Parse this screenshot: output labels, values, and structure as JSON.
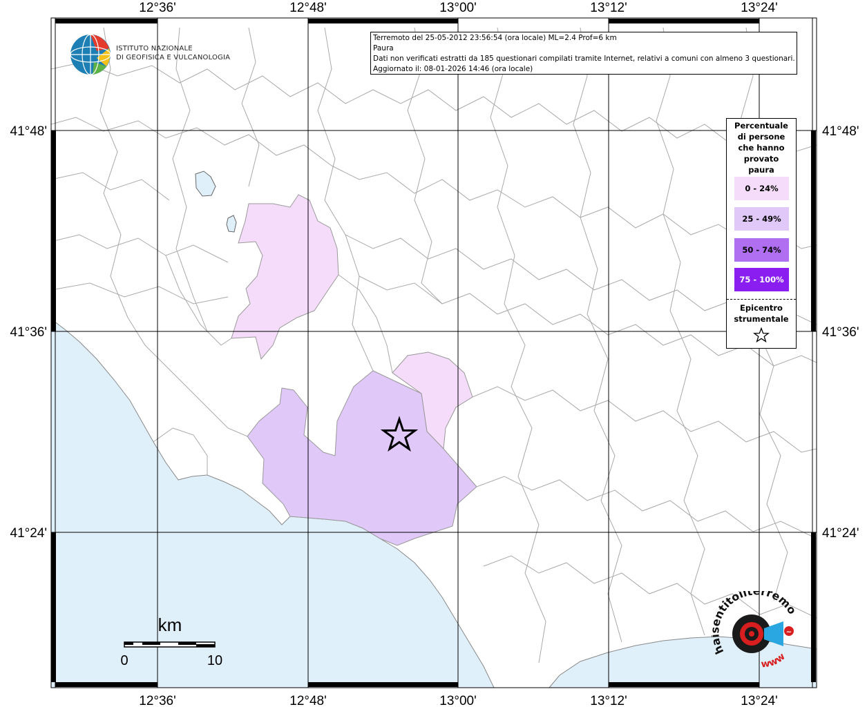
{
  "map": {
    "lon_ticks": [
      "12°36'",
      "12°48'",
      "13°00'",
      "13°12'",
      "13°24'"
    ],
    "lat_ticks": [
      "41°48'",
      "41°36'",
      "41°24'"
    ]
  },
  "info_box": {
    "line1": "Terremoto del 25-05-2012 23:56:54 (ora locale) ML=2.4 Prof=6 km",
    "line2": "Paura",
    "line3": "Dati non verificati estratti da 185 questionari compilati tramite Internet, relativi a comuni con almeno 3 questionari.",
    "line4": "Aggiornato il: 08-01-2026 14:46 (ora locale)"
  },
  "logo": {
    "line1": "ISTITUTO NAZIONALE",
    "line2": "DI GEOFISICA E VULCANOLOGIA"
  },
  "legend": {
    "title": [
      "Percentuale",
      "di persone",
      "che hanno",
      "provato",
      "paura"
    ],
    "classes": [
      {
        "label": "0 - 24%",
        "color": "#f5dcfa",
        "text_color": "#000000"
      },
      {
        "label": "25 - 49%",
        "color": "#e0c8f8",
        "text_color": "#000000"
      },
      {
        "label": "50 - 74%",
        "color": "#b06ef0",
        "text_color": "#000000"
      },
      {
        "label": "75 - 100%",
        "color": "#8a1ef0",
        "text_color": "#ffffff"
      }
    ],
    "epicenter_label": [
      "Epicentro",
      "strumentale"
    ]
  },
  "scale_bar": {
    "unit": "km",
    "start": "0",
    "end": "10"
  },
  "watermark": {
    "text_top": "haisentitoilterremoto.it",
    "text_bottom": "www"
  },
  "colors": {
    "sea": "#dff0fb",
    "land": "#ffffff",
    "borders": "#a0a0a0",
    "grid": "#000000"
  }
}
